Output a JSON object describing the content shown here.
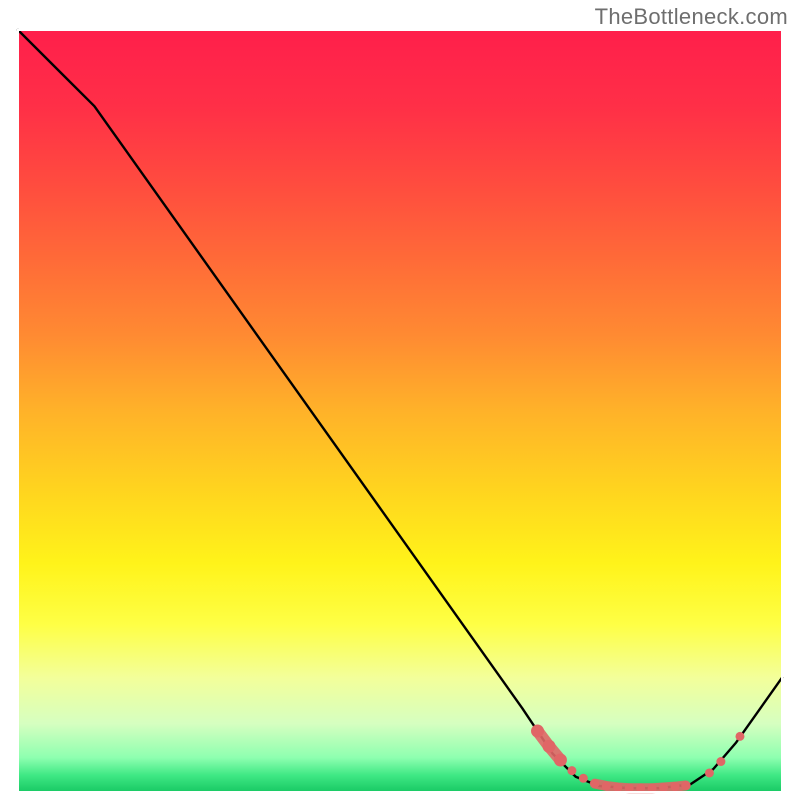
{
  "attribution": "TheBottleneck.com",
  "chart_data": {
    "type": "line",
    "title": "",
    "xlabel": "",
    "ylabel": "",
    "xlim": [
      0,
      100
    ],
    "ylim": [
      0,
      100
    ],
    "grid": false,
    "legend": false,
    "background": {
      "type": "vertical-gradient",
      "stops": [
        {
          "offset": 0.0,
          "color": "#ff1f4b"
        },
        {
          "offset": 0.1,
          "color": "#ff2f47"
        },
        {
          "offset": 0.2,
          "color": "#ff4b3f"
        },
        {
          "offset": 0.3,
          "color": "#ff6a38"
        },
        {
          "offset": 0.4,
          "color": "#ff8a32"
        },
        {
          "offset": 0.5,
          "color": "#ffb229"
        },
        {
          "offset": 0.6,
          "color": "#ffd31f"
        },
        {
          "offset": 0.7,
          "color": "#fff31a"
        },
        {
          "offset": 0.78,
          "color": "#feff45"
        },
        {
          "offset": 0.85,
          "color": "#f3ff9a"
        },
        {
          "offset": 0.91,
          "color": "#d6ffc0"
        },
        {
          "offset": 0.955,
          "color": "#8effb0"
        },
        {
          "offset": 0.978,
          "color": "#3fe884"
        },
        {
          "offset": 1.0,
          "color": "#18c964"
        }
      ]
    },
    "series": [
      {
        "name": "bottleneck-curve",
        "color": "#000000",
        "points": [
          {
            "x": 0,
            "y": 100
          },
          {
            "x": 6,
            "y": 94
          },
          {
            "x": 10,
            "y": 90
          },
          {
            "x": 66,
            "y": 11
          },
          {
            "x": 70,
            "y": 5
          },
          {
            "x": 73,
            "y": 2
          },
          {
            "x": 76,
            "y": 0.8
          },
          {
            "x": 80,
            "y": 0.5
          },
          {
            "x": 84,
            "y": 0.5
          },
          {
            "x": 88,
            "y": 1.0
          },
          {
            "x": 91,
            "y": 3.0
          },
          {
            "x": 94,
            "y": 6.5
          },
          {
            "x": 100,
            "y": 15
          }
        ]
      }
    ],
    "markers": {
      "name": "highlight-dots",
      "color": "#e06666",
      "radius_small": 4.5,
      "radius_large": 6.5,
      "points": [
        {
          "x": 68.0,
          "y": 8.0,
          "r": "large"
        },
        {
          "x": 69.5,
          "y": 6.0,
          "r": "large"
        },
        {
          "x": 71.0,
          "y": 4.2,
          "r": "large"
        },
        {
          "x": 72.5,
          "y": 2.8,
          "r": "small"
        },
        {
          "x": 74.0,
          "y": 1.8,
          "r": "small"
        },
        {
          "x": 75.5,
          "y": 1.1,
          "r": "small"
        },
        {
          "x": 77.0,
          "y": 0.8,
          "r": "small"
        },
        {
          "x": 78.5,
          "y": 0.6,
          "r": "small"
        },
        {
          "x": 80.0,
          "y": 0.5,
          "r": "small"
        },
        {
          "x": 81.5,
          "y": 0.5,
          "r": "small"
        },
        {
          "x": 83.0,
          "y": 0.5,
          "r": "small"
        },
        {
          "x": 84.5,
          "y": 0.6,
          "r": "small"
        },
        {
          "x": 86.0,
          "y": 0.7,
          "r": "small"
        },
        {
          "x": 87.4,
          "y": 0.85,
          "r": "small"
        },
        {
          "x": 90.5,
          "y": 2.5,
          "r": "small"
        },
        {
          "x": 92.0,
          "y": 4.0,
          "r": "small"
        },
        {
          "x": 94.5,
          "y": 7.3,
          "r": "small"
        }
      ]
    },
    "frame": {
      "color": "#ffffff",
      "width": 2
    }
  }
}
